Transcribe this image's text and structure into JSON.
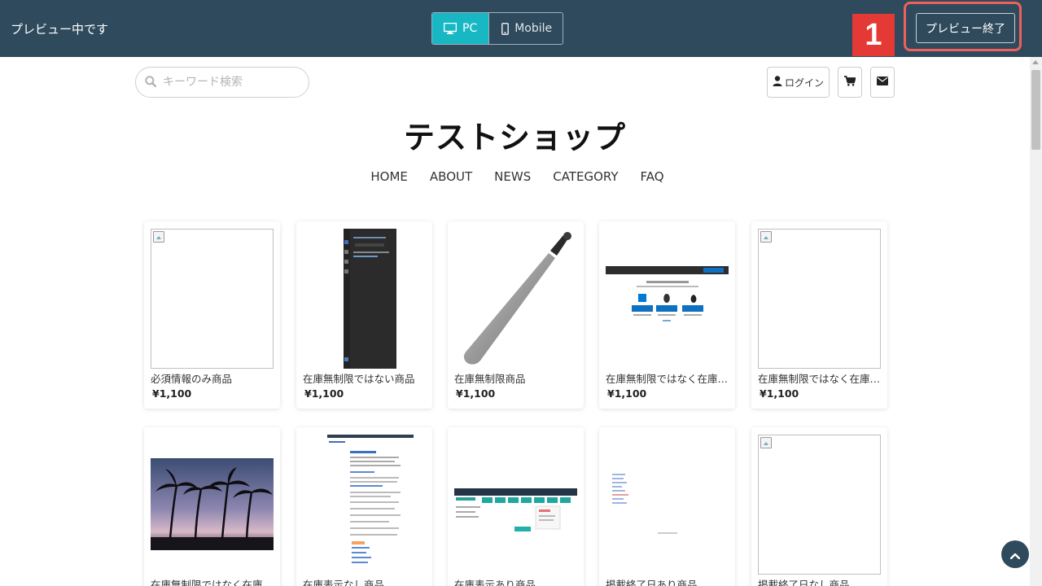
{
  "preview_bar": {
    "label": "プレビュー中です",
    "pc_label": "PC",
    "mobile_label": "Mobile",
    "step_number": "1",
    "end_preview_label": "プレビュー終了"
  },
  "header": {
    "search_placeholder": "キーワード検索",
    "login_label": "ログイン",
    "shop_title": "テストショップ"
  },
  "nav": {
    "items": [
      "HOME",
      "ABOUT",
      "NEWS",
      "CATEGORY",
      "FAQ"
    ]
  },
  "products": [
    {
      "name": "必須情報のみ商品",
      "price": "¥1,100",
      "image": "broken"
    },
    {
      "name": "在庫無制限ではない商品",
      "price": "¥1,100",
      "image": "dark-app-screenshot"
    },
    {
      "name": "在庫無制限商品",
      "price": "¥1,100",
      "image": "baseball-bat"
    },
    {
      "name": "在庫無制限ではなく在庫表示あり商品",
      "price": "¥1,100",
      "image": "download-page-screenshot"
    },
    {
      "name": "在庫無制限ではなく在庫表示なし商品",
      "price": "¥1,100",
      "image": "broken"
    },
    {
      "name": "在庫無制限ではなく在庫表示あり商品",
      "price": "",
      "image": "palm-trees-sunset"
    },
    {
      "name": "在庫表示なし商品",
      "price": "",
      "image": "document-screenshot"
    },
    {
      "name": "在庫表示あり商品",
      "price": "",
      "image": "dashboard-screenshot"
    },
    {
      "name": "掲載終了日あり商品",
      "price": "",
      "image": "blank-page-screenshot"
    },
    {
      "name": "掲載終了日なし商品",
      "price": "",
      "image": "broken"
    }
  ],
  "colors": {
    "preview_bar": "#2f4a5c",
    "accent": "#17b8c4",
    "highlight": "#f0605a",
    "badge": "#e53935"
  }
}
